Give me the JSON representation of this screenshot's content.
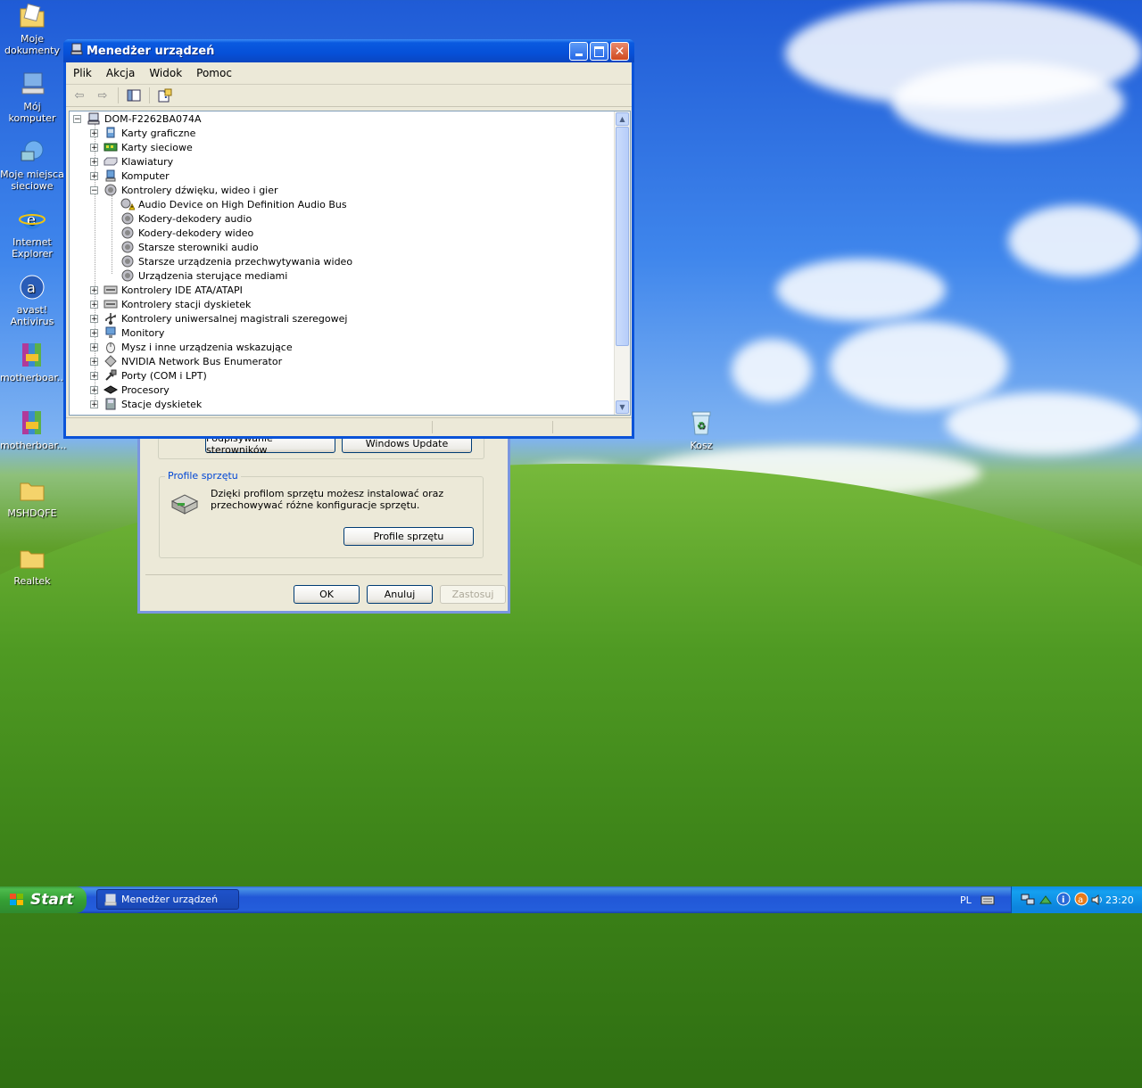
{
  "desktop": {
    "icons": [
      {
        "label": "Moje dokumenty"
      },
      {
        "label": "Mój komputer"
      },
      {
        "label": "Moje miejsca sieciowe"
      },
      {
        "label": "Internet Explorer"
      },
      {
        "label": "avast! Antivirus"
      },
      {
        "label": "motherboar..."
      },
      {
        "label": "motherboar..."
      },
      {
        "label": "MSHDQFE"
      },
      {
        "label": "Realtek"
      },
      {
        "label": "Kosz"
      }
    ]
  },
  "back_dialog": {
    "buttons": {
      "driver_signing": "Podpisywanie sterowników",
      "windows_update": "Windows Update"
    },
    "hw_profiles": {
      "group_label": "Profile sprzętu",
      "description": "Dzięki profilom sprzętu możesz instalować oraz przechowywać różne konfiguracje sprzętu.",
      "button": "Profile sprzętu"
    },
    "footer": {
      "ok": "OK",
      "cancel": "Anuluj",
      "apply": "Zastosuj"
    }
  },
  "device_manager": {
    "title": "Menedżer urządzeń",
    "menu": [
      "Plik",
      "Akcja",
      "Widok",
      "Pomoc"
    ],
    "tree": {
      "root": "DOM-F2262BA074A",
      "items": [
        {
          "label": "Karty graficzne",
          "expanded": false
        },
        {
          "label": "Karty sieciowe",
          "expanded": false
        },
        {
          "label": "Klawiatury",
          "expanded": false
        },
        {
          "label": "Komputer",
          "expanded": false
        },
        {
          "label": "Kontrolery dźwięku, wideo i gier",
          "expanded": true,
          "children": [
            {
              "label": "Audio Device on High Definition Audio Bus",
              "warning": true
            },
            {
              "label": "Kodery-dekodery audio"
            },
            {
              "label": "Kodery-dekodery wideo"
            },
            {
              "label": "Starsze sterowniki audio"
            },
            {
              "label": "Starsze urządzenia przechwytywania wideo"
            },
            {
              "label": "Urządzenia sterujące mediami"
            }
          ]
        },
        {
          "label": "Kontrolery IDE ATA/ATAPI",
          "expanded": false
        },
        {
          "label": "Kontrolery stacji dyskietek",
          "expanded": false
        },
        {
          "label": "Kontrolery uniwersalnej magistrali szeregowej",
          "expanded": false
        },
        {
          "label": "Monitory",
          "expanded": false
        },
        {
          "label": "Mysz i inne urządzenia wskazujące",
          "expanded": false
        },
        {
          "label": "NVIDIA Network Bus Enumerator",
          "expanded": false
        },
        {
          "label": "Porty (COM i LPT)",
          "expanded": false
        },
        {
          "label": "Procesory",
          "expanded": false
        },
        {
          "label": "Stacje dyskietek",
          "expanded": false
        }
      ]
    }
  },
  "taskbar": {
    "start_label": "Start",
    "task_button": "Menedżer urządzeń",
    "language": "PL",
    "clock": "23:20"
  }
}
